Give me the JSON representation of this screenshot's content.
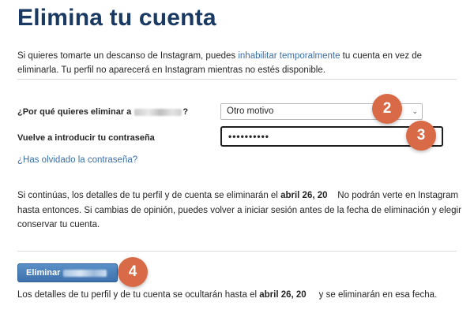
{
  "title": "Elimina tu cuenta",
  "intro": {
    "before_link": "Si quieres tomarte un descanso de Instagram, puedes ",
    "link": "inhabilitar temporalmente",
    "after_link": " tu cuenta en vez de eliminarla. Tu perfil no aparecerá en Instagram mientras no estés disponible."
  },
  "reason": {
    "label_prefix": "¿Por qué quieres eliminar a",
    "label_suffix": "?",
    "selected": "Otro motivo",
    "chevron_icon": "chevron-down-icon"
  },
  "password": {
    "label": "Vuelve a introducir tu contraseña",
    "value": "••••••••••"
  },
  "forgot_link": "¿Has olvidado la contraseña?",
  "info": {
    "part1": "Si continúas, los detalles de tu perfil y de cuenta se eliminarán el ",
    "date": "abril 26, 20",
    "part2": "    No podrán verte en Instagram hasta entonces. Si cambias de opinión, puedes volver a iniciar sesión antes de la fecha de eliminación y elegir conservar tu cuenta."
  },
  "delete_button": {
    "label": "Eliminar"
  },
  "footnote": {
    "part1": "Los detalles de tu perfil y de tu cuenta se ocultarán hasta el ",
    "date": "abril 26, 20",
    "part2": "     y se eliminarán en esa fecha."
  },
  "badges": [
    "2",
    "3",
    "4"
  ],
  "colors": {
    "title": "#1a3a63",
    "link": "#3a6fa8",
    "button": "#3f72ad",
    "badge": "#d96a47"
  }
}
